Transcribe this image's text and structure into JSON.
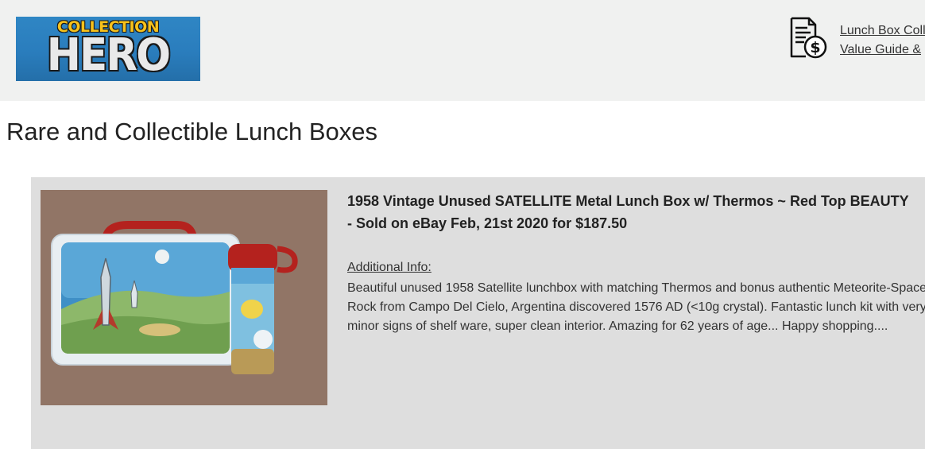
{
  "header": {
    "logo": {
      "top_text": "COLLECTION",
      "main_text": "HERO"
    },
    "guide_icon": "price-document-dollar-icon",
    "guide_link": {
      "line1": "Lunch Box Coll",
      "line2": "Value Guide &"
    }
  },
  "page_title": "Rare and Collectible Lunch Boxes",
  "listing": {
    "image": "vintage-satellite-lunch-box-and-thermos-photo",
    "title_line1": "1958 Vintage Unused SATELLITE Metal Lunch Box w/ Thermos ~ Red Top BEAUTY",
    "title_line2": "- Sold on eBay Feb, 21st 2020 for $187.50",
    "info_label": "Additional Info:",
    "description": [
      "Beautiful unused 1958 Satellite lunchbox with matching Thermos and bonus authentic Meteorite-Space",
      "Rock from Campo Del Cielo, Argentina discovered 1576 AD (<10g crystal). Fantastic lunch kit with very",
      "minor signs of shelf ware, super clean interior. Amazing for 62 years of age... Happy shopping...."
    ]
  },
  "colors": {
    "header_bg": "#f0f1f0",
    "card_bg": "#dedede",
    "logo_blue": "#2a7dbd",
    "logo_yellow": "#f7c21b"
  }
}
